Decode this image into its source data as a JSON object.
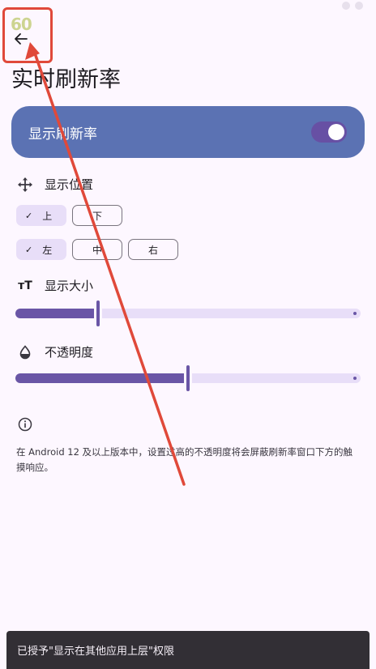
{
  "overlay": {
    "fps": "60"
  },
  "header": {
    "title": "实时刷新率"
  },
  "toggle": {
    "label": "显示刷新率",
    "checked": true
  },
  "position_section": {
    "label": "显示位置",
    "vertical": [
      {
        "label": "上",
        "selected": true
      },
      {
        "label": "下",
        "selected": false
      }
    ],
    "horizontal": [
      {
        "label": "左",
        "selected": true
      },
      {
        "label": "中",
        "selected": false
      },
      {
        "label": "右",
        "selected": false
      }
    ]
  },
  "size_section": {
    "label": "显示大小",
    "value_fraction": 0.24
  },
  "opacity_section": {
    "label": "不透明度",
    "value_fraction": 0.5
  },
  "info": {
    "text": "在 Android 12 及以上版本中，设置过高的不透明度将会屏蔽刷新率窗口下方的触摸响应。"
  },
  "snackbar": {
    "text": "已授予\"显示在其他应用上层\"权限"
  },
  "colors": {
    "accent": "#6750a4",
    "card": "#5b72b3",
    "background": "#fdf7ff",
    "annotation": "#e0493a"
  }
}
